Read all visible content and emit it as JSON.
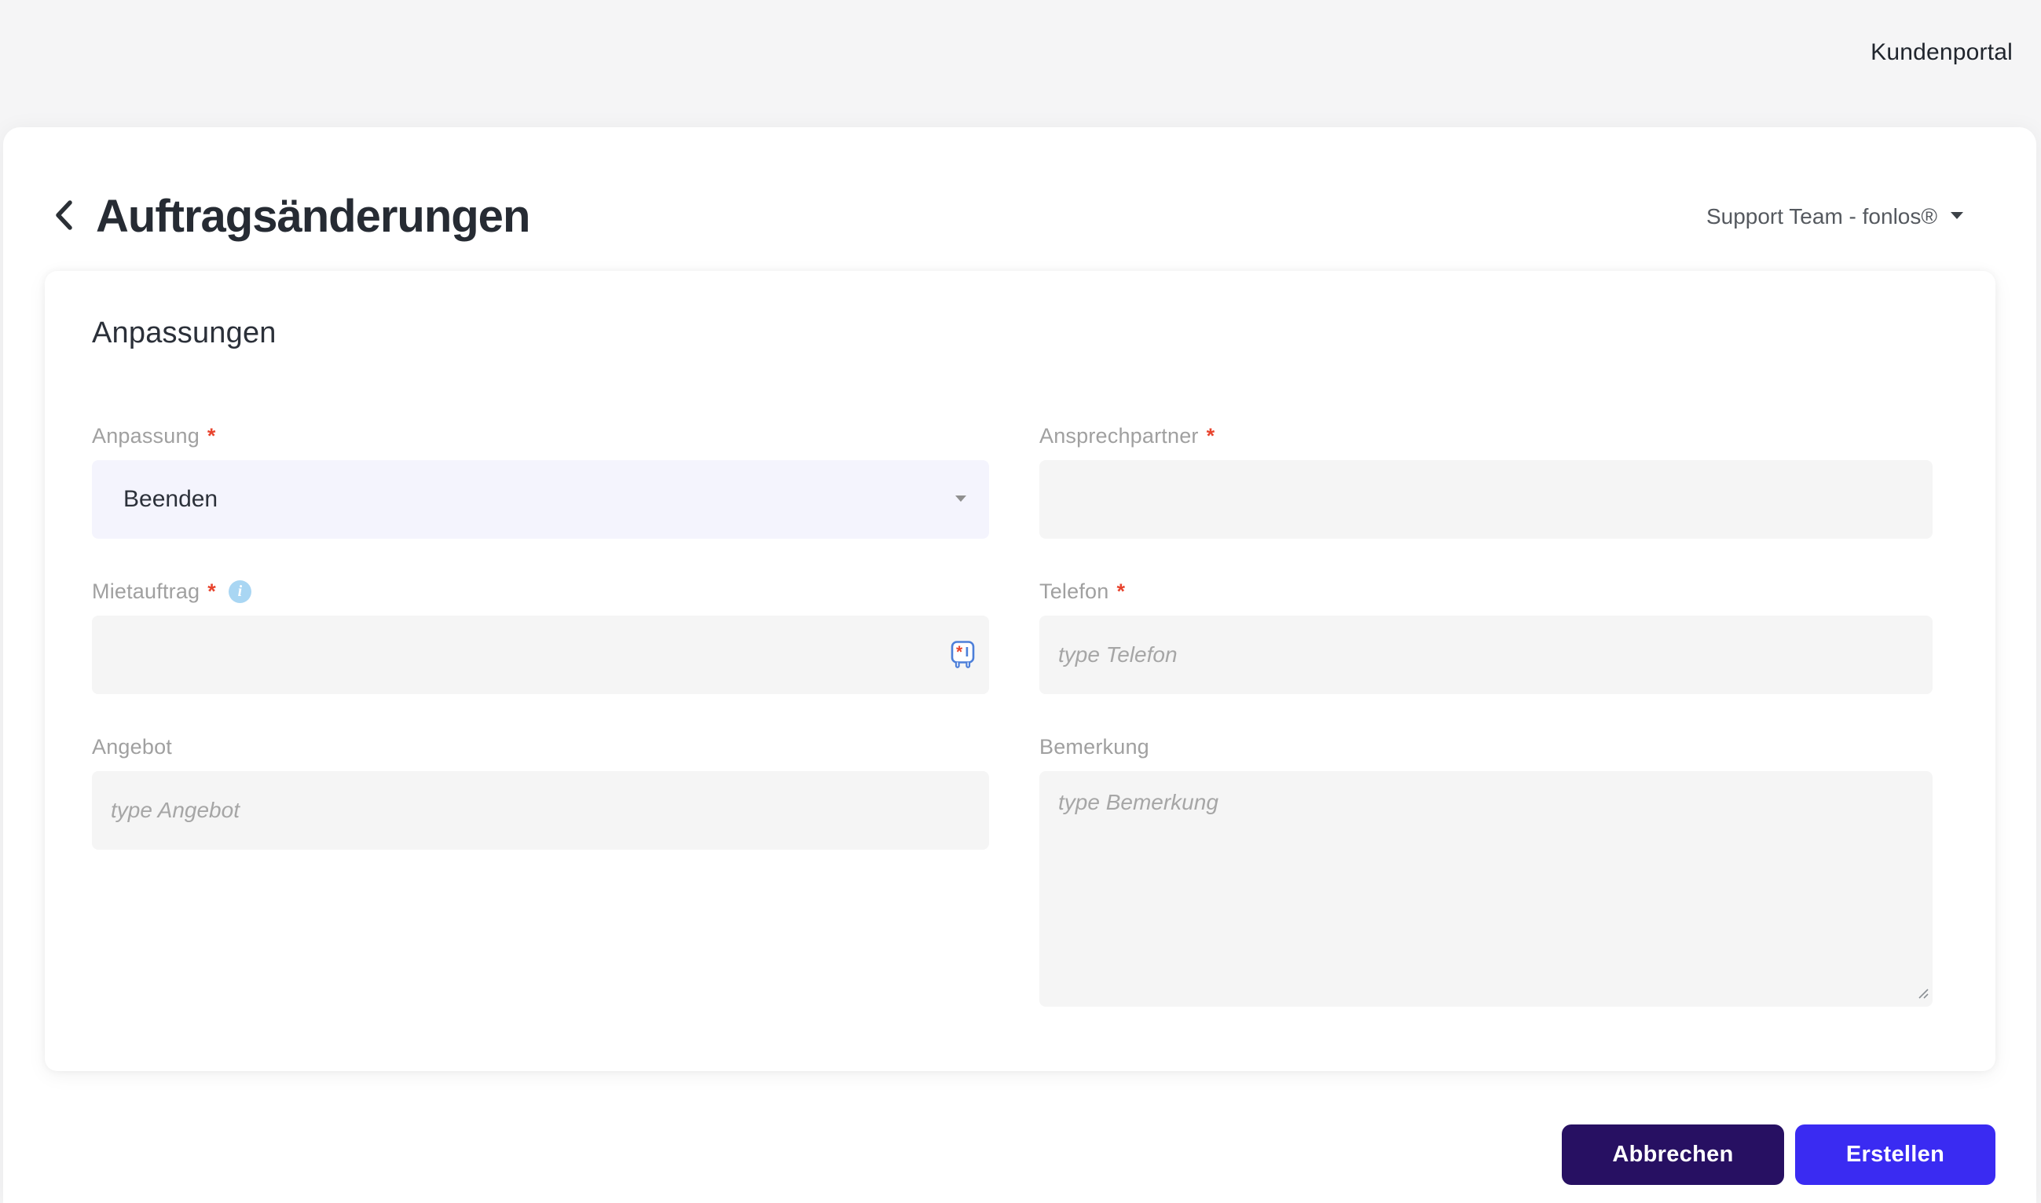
{
  "topbar": {
    "brand": "Kundenportal"
  },
  "header": {
    "title": "Auftragsänderungen",
    "account_label": "Support Team - fonlos®"
  },
  "required_marker": "*",
  "card": {
    "section_title": "Anpassungen",
    "fields": {
      "anpassung": {
        "label": "Anpassung",
        "required": true,
        "type": "select",
        "value": "Beenden"
      },
      "ansprechpartner": {
        "label": "Ansprechpartner",
        "required": true,
        "type": "text",
        "value": "",
        "placeholder": ""
      },
      "mietauftrag": {
        "label": "Mietauftrag",
        "required": true,
        "type": "text",
        "value": "",
        "placeholder": "",
        "info_icon": "info-icon",
        "addon_icon": "required-field-icon"
      },
      "telefon": {
        "label": "Telefon",
        "required": true,
        "type": "text",
        "value": "",
        "placeholder": "type Telefon"
      },
      "angebot": {
        "label": "Angebot",
        "required": false,
        "type": "text",
        "value": "",
        "placeholder": "type Angebot"
      },
      "bemerkung": {
        "label": "Bemerkung",
        "required": false,
        "type": "textarea",
        "value": "",
        "placeholder": "type Bemerkung"
      }
    }
  },
  "actions": {
    "cancel_label": "Abbrechen",
    "submit_label": "Erstellen"
  },
  "colors": {
    "accent_primary": "#3a2bf2",
    "accent_dark": "#271062",
    "required_asterisk": "#e8442e",
    "select_background": "#f4f4fd",
    "field_background": "#f5f5f5",
    "info_bubble": "#a9d6f3",
    "page_background": "#f5f5f6"
  }
}
